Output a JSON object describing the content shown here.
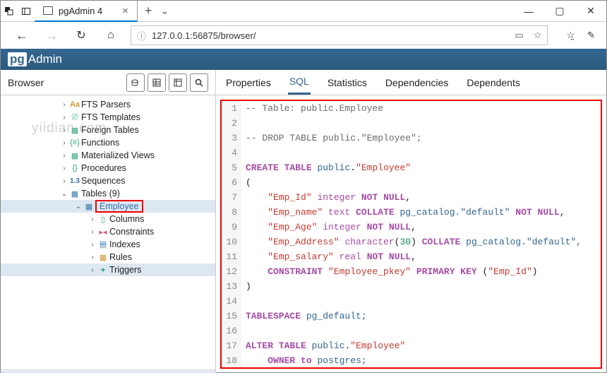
{
  "window": {
    "tab_title": "pgAdmin 4",
    "url": "127.0.0.1:56875/browser/"
  },
  "app": {
    "brand_pg": "pg",
    "brand_admin": "Admin"
  },
  "browser_panel": {
    "label": "Browser"
  },
  "main_tabs": {
    "properties": "Properties",
    "sql": "SQL",
    "statistics": "Statistics",
    "dependencies": "Dependencies",
    "dependents": "Dependents"
  },
  "tree": {
    "fts_parsers": "FTS Parsers",
    "fts_templates": "FTS Templates",
    "foreign_tables": "Foreign Tables",
    "functions": "Functions",
    "mat_views": "Materialized Views",
    "procedures": "Procedures",
    "sequences": "Sequences",
    "tables": "Tables (9)",
    "employee": "Employee",
    "columns": "Columns",
    "constraints": "Constraints",
    "indexes": "Indexes",
    "rules": "Rules",
    "triggers": "Triggers"
  },
  "watermark": "yiidian.com",
  "sql": {
    "lines": [
      {
        "n": 1,
        "type": "comment",
        "text": "-- Table: public.Employee"
      },
      {
        "n": 2,
        "type": "blank",
        "text": ""
      },
      {
        "n": 3,
        "type": "comment",
        "text": "-- DROP TABLE public.\"Employee\";"
      },
      {
        "n": 4,
        "type": "blank",
        "text": ""
      },
      {
        "n": 5,
        "type": "create",
        "kw1": "CREATE",
        "kw2": "TABLE",
        "schema": "public",
        "name": "\"Employee\""
      },
      {
        "n": 6,
        "type": "plain",
        "text": "("
      },
      {
        "n": 7,
        "type": "col",
        "col": "\"Emp_Id\"",
        "ctype": "integer",
        "nn": "NOT NULL",
        "tail": ","
      },
      {
        "n": 8,
        "type": "col_collate",
        "col": "\"Emp_name\"",
        "ctype": "text",
        "collate_kw": "COLLATE",
        "collate_val": "pg_catalog.\"default\"",
        "nn": "NOT NULL",
        "tail": ","
      },
      {
        "n": 9,
        "type": "col",
        "col": "\"Emp_Age\"",
        "ctype": "integer",
        "nn": "NOT NULL",
        "tail": ","
      },
      {
        "n": 10,
        "type": "col_char",
        "col": "\"Emp_Address\"",
        "ctype": "character",
        "len": "30",
        "collate_kw": "COLLATE",
        "collate_val": "pg_catalog.\"default\",",
        "tail": ""
      },
      {
        "n": 11,
        "type": "col",
        "col": "\"Emp_salary\"",
        "ctype": "real",
        "nn": "NOT NULL",
        "tail": ","
      },
      {
        "n": 12,
        "type": "constraint",
        "kw": "CONSTRAINT",
        "name": "\"Employee_pkey\"",
        "pk": "PRIMARY KEY",
        "col": "\"Emp_Id\""
      },
      {
        "n": 13,
        "type": "plain",
        "text": ")"
      },
      {
        "n": 14,
        "type": "blank",
        "text": ""
      },
      {
        "n": 15,
        "type": "ts",
        "kw": "TABLESPACE",
        "val": "pg_default;"
      },
      {
        "n": 16,
        "type": "blank",
        "text": ""
      },
      {
        "n": 17,
        "type": "alter",
        "kw1": "ALTER",
        "kw2": "TABLE",
        "schema": "public",
        "name": "\"Employee\""
      },
      {
        "n": 18,
        "type": "owner",
        "kw1": "OWNER",
        "kw2": "to",
        "val": "postgres;"
      }
    ]
  }
}
